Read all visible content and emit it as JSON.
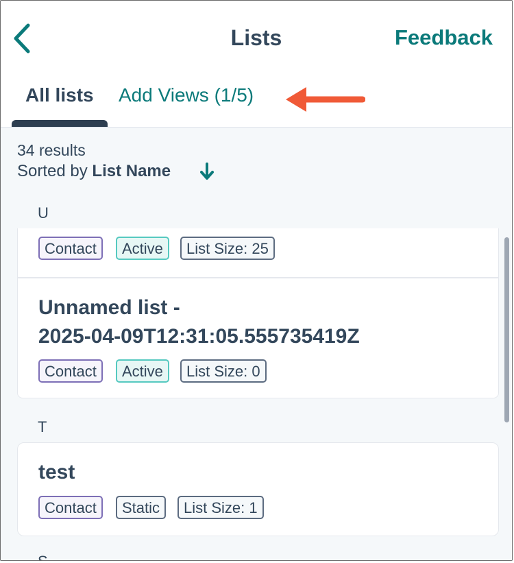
{
  "header": {
    "title": "Lists",
    "feedback_label": "Feedback",
    "back_icon": "chevron-left-icon"
  },
  "tabs": [
    {
      "label": "All lists",
      "selected": true
    },
    {
      "label": "Add Views (1/5)",
      "selected": false
    }
  ],
  "annotation": {
    "icon": "arrow-left-icon",
    "color": "#f05a37"
  },
  "summary": {
    "results": "34 results",
    "sorted_prefix": "Sorted by",
    "sorted_field": "List Name",
    "sort_icon": "arrow-down-icon"
  },
  "sections": [
    {
      "letter": "U",
      "items": [
        {
          "title": "",
          "tags": [
            "Contact",
            "Active",
            "List Size: 25"
          ]
        },
        {
          "title_line1": "Unnamed list -",
          "title_line2": "2025-04-09T12:31:05.555735419Z",
          "tags": [
            "Contact",
            "Active",
            "List Size: 0"
          ]
        }
      ]
    },
    {
      "letter": "T",
      "items": [
        {
          "title": "test",
          "tags": [
            "Contact",
            "Static",
            "List Size: 1"
          ]
        }
      ]
    },
    {
      "letter": "S"
    }
  ],
  "colors": {
    "accent": "#0b7a7a",
    "text": "#33475b",
    "active_tag_border": "#56c9c0",
    "contact_tag_border": "#7d6fb6"
  }
}
